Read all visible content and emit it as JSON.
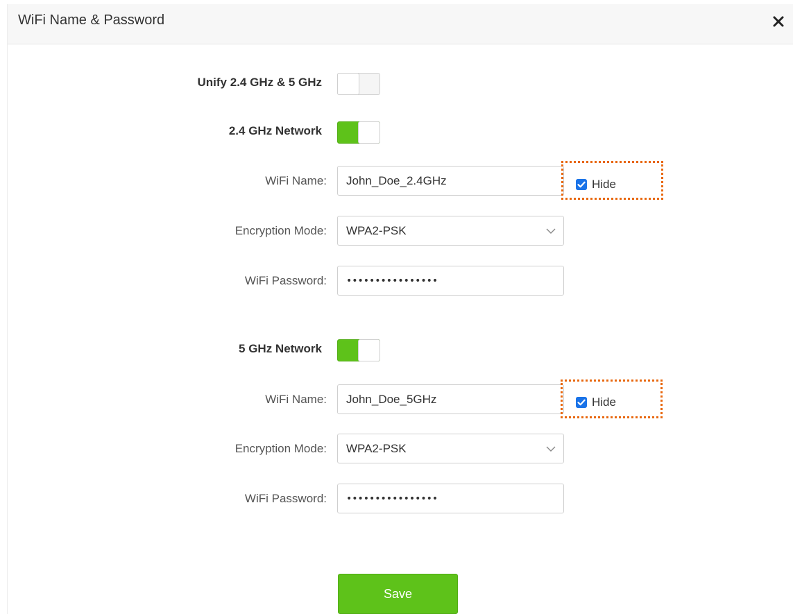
{
  "dialog": {
    "title": "WiFi Name & Password",
    "close_icon": "close-icon"
  },
  "unify": {
    "label": "Unify 2.4 GHz & 5 GHz",
    "enabled": false
  },
  "network_24": {
    "label": "2.4 GHz Network",
    "enabled": true,
    "wifi_name_label": "WiFi Name:",
    "wifi_name": "John_Doe_2.4GHz",
    "hide_label": "Hide",
    "hide_checked": true,
    "encryption_label": "Encryption Mode:",
    "encryption_value": "WPA2-PSK",
    "password_label": "WiFi Password:",
    "password_value": "••••••••••••••••"
  },
  "network_5": {
    "label": "5 GHz Network",
    "enabled": true,
    "wifi_name_label": "WiFi Name:",
    "wifi_name": "John_Doe_5GHz",
    "hide_label": "Hide",
    "hide_checked": true,
    "encryption_label": "Encryption Mode:",
    "encryption_value": "WPA2-PSK",
    "password_label": "WiFi Password:",
    "password_value": "••••••••••••••••"
  },
  "actions": {
    "save_label": "Save"
  },
  "colors": {
    "accent_green": "#5ec21a",
    "highlight_orange": "#e8680f",
    "checkbox_blue": "#1a73e8"
  }
}
